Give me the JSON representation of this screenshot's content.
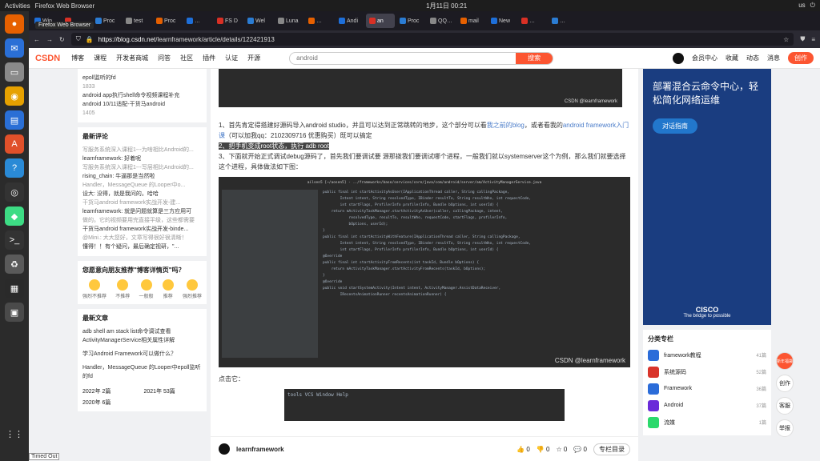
{
  "system": {
    "activities": "Activities",
    "app": "Firefox Web Browser",
    "clock": "1月11日 00:21",
    "locale": "us",
    "timed_out": "Timed Out",
    "tooltip": "Firefox Web Browser"
  },
  "tabs": [
    {
      "label": "Win"
    },
    {
      "label": "…"
    },
    {
      "label": "Proc"
    },
    {
      "label": "test"
    },
    {
      "label": "Proc"
    },
    {
      "label": "…"
    },
    {
      "label": "FS D"
    },
    {
      "label": "Wel"
    },
    {
      "label": "Luna"
    },
    {
      "label": "…"
    },
    {
      "label": "Andi"
    },
    {
      "label": "an",
      "active": true
    },
    {
      "label": "Proc"
    },
    {
      "label": "QQ…"
    },
    {
      "label": "mail"
    },
    {
      "label": "New"
    },
    {
      "label": "…"
    },
    {
      "label": "…"
    }
  ],
  "url": {
    "host": "https://blog.csdn.net",
    "path": "/learnframework/article/details/122421913"
  },
  "csdn": {
    "logo": "CSDN",
    "nav": [
      "博客",
      "课程",
      "开发者商城",
      "问答",
      "社区",
      "插件",
      "认证",
      "开源"
    ],
    "search_placeholder": "android",
    "search_btn": "搜索",
    "user": [
      "会员中心",
      "收藏",
      "动态",
      "消息"
    ],
    "create": "创作"
  },
  "left": {
    "top_lines": [
      "epoll监听的fd",
      "android app执行shell命令视频课程补充",
      "android 10/11适配-干货马android"
    ],
    "top_counts": [
      "1833",
      "1405"
    ],
    "comments_title": "最新评论",
    "comments": [
      "写服务系统深入课程1---为啥相比Android的...",
      "learnframework: 好着呢",
      "写服务系统深入课程1---写层相比Android的...",
      "rising_chain: 牛逼那是当然啦",
      "Handler，MessageQueue 的Looper中o...",
      "设大: 没得，就是我问的。哈哈",
      "干货马android framework实战开发-建...",
      "learnframework: 就是问题就算是三方应用可",
      "做的。它的视频要用完直接平级，这些都需要",
      "干货马android framework实战开发-binde...",
      "@Mini.: 大大您好，文章写得很好很清晰！",
      "懂得！！有个疑问，最后确定视研，\"..."
    ],
    "survey_title": "您愿意向朋友推荐\"博客详情页\"吗？",
    "survey": [
      "强烈不推荐",
      "不推荐",
      "一般般",
      "推荐",
      "强烈推荐"
    ],
    "recent_title": "最新文章",
    "recent": [
      "adb shell am stack list命令调试查看ActivityManagerService相关属性详解",
      "学习Android Framework可以做什么？",
      "Handler，MessageQueue 的Looper中epoll监听的fd"
    ],
    "archive": [
      "2022年  2篇",
      "2021年  53篇",
      "2020年  6篇"
    ]
  },
  "article": {
    "wm1": "CSDN @learnframework",
    "p1a": "1、首先肯定得搭建好源码导入android studio，并且可以达到正常跳转的地步，这个部分可以看",
    "p1link1": "我之前的blog",
    "p1b": "，或者看我的",
    "p1link2": "android framework入门课",
    "p1c": "（可以加我qq：2102309716 优惠购买）既可以搞定",
    "p2": "2、把手机变成root状态，执行 adb root",
    "p3": "3、下面就开始正式调试debug源码了，首先我们要调试要 源那拨我们要调试哪个进程，一般我们就以systemserver这个为例，那么我们就要选择这个进程，具体做法如下图：",
    "code_title": "ailsen5 [~/aosen5] - ../frameworks/base/services/core/java/com/android/server/am/ActivityManagerService.java",
    "code_lines": [
      "public final int startActivityAsUser(IApplicationThread caller, String callingPackage,",
      "        Intent intent, String resolvedType, IBinder resultTo, String resultWho, int requestCode,",
      "        int startFlags, ProfilerInfo profilerInfo, Bundle bOptions, int userId) {",
      "    return mActivityTaskManager.startActivityAsUser(caller, callingPackage, intent,",
      "            resolvedType, resultTo, resultWho, requestCode, startFlags, profilerInfo,",
      "            bOptions, userId);",
      "}",
      "public final int startActivityWithFeature(IApplicationThread caller, String callingPackage,",
      "        Intent intent, String resolvedType, IBinder resultTo, String resultWho, int requestCode,",
      "        int startFlags, ProfilerInfo profilerInfo, Bundle bOptions, int userId) {",
      "@Override",
      "public final int startActivityFromRecents(int taskId, Bundle bOptions) {",
      "    return mActivityTaskManager.startActivityFromRecents(taskId, bOptions);",
      "}",
      "@Override",
      "public void startSystemActivity(Intent intent, ActivityManager.AssistDataReceiver,",
      "        IRecentsAnimationRunner recentsAnimationRunner) {"
    ],
    "wm2": "CSDN @learnframework",
    "p4": "点击它：",
    "code2": "tools  VCS  Window  Help"
  },
  "bottom": {
    "author": "learnframework",
    "like": "0",
    "unlike": "0",
    "fav": "0",
    "comment": "0",
    "toc": "专栏目录"
  },
  "right": {
    "ad_title": "部署混合云命令中心，轻松简化网络运维",
    "ad_cta": "对话指南",
    "ad_brand": "CISCO",
    "ad_slogan": "The bridge to possible",
    "cats_title": "分类专栏",
    "cats": [
      {
        "name": "framework教程",
        "count": "41篇",
        "color": "#2b6cd9"
      },
      {
        "name": "系统源码",
        "count": "52篇",
        "color": "#d9342b"
      },
      {
        "name": "Framework",
        "count": "36篇",
        "color": "#2b6cd9"
      },
      {
        "name": "Android",
        "count": "37篇",
        "color": "#6a2bd9"
      },
      {
        "name": "流媒",
        "count": "1篇",
        "color": "#2bd96c"
      }
    ]
  },
  "float": {
    "new": "新年福袋",
    "a": "创作",
    "b": "客服",
    "c": "举报"
  }
}
